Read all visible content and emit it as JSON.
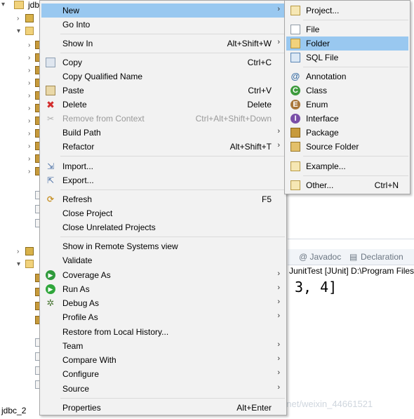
{
  "explorer": {
    "top_project_label": "jdb",
    "bottom_project_label": "jdbc_2"
  },
  "console": {
    "tabs": [
      "@ Javadoc",
      "Declaration"
    ],
    "run_label": "JunitTest [JUnit] D:\\Program Files",
    "output": "3, 4]"
  },
  "watermark": "https://blog.csdn.net/weixin_44661521",
  "menu": {
    "items": [
      {
        "label": "New",
        "shortcut": "",
        "submenu": true,
        "selected": true
      },
      {
        "label": "Go Into",
        "shortcut": ""
      },
      {
        "label": "Show In",
        "shortcut": "Alt+Shift+W",
        "submenu": true
      },
      {
        "label": "Copy",
        "shortcut": "Ctrl+C"
      },
      {
        "label": "Copy Qualified Name",
        "shortcut": ""
      },
      {
        "label": "Paste",
        "shortcut": "Ctrl+V"
      },
      {
        "label": "Delete",
        "shortcut": "Delete"
      },
      {
        "label": "Remove from Context",
        "shortcut": "Ctrl+Alt+Shift+Down",
        "disabled": true
      },
      {
        "label": "Build Path",
        "shortcut": "",
        "submenu": true
      },
      {
        "label": "Refactor",
        "shortcut": "Alt+Shift+T",
        "submenu": true
      },
      {
        "label": "Import...",
        "shortcut": ""
      },
      {
        "label": "Export...",
        "shortcut": ""
      },
      {
        "label": "Refresh",
        "shortcut": "F5"
      },
      {
        "label": "Close Project",
        "shortcut": ""
      },
      {
        "label": "Close Unrelated Projects",
        "shortcut": ""
      },
      {
        "label": "Show in Remote Systems view",
        "shortcut": ""
      },
      {
        "label": "Validate",
        "shortcut": ""
      },
      {
        "label": "Coverage As",
        "shortcut": "",
        "submenu": true
      },
      {
        "label": "Run As",
        "shortcut": "",
        "submenu": true
      },
      {
        "label": "Debug As",
        "shortcut": "",
        "submenu": true
      },
      {
        "label": "Profile As",
        "shortcut": "",
        "submenu": true
      },
      {
        "label": "Restore from Local History...",
        "shortcut": ""
      },
      {
        "label": "Team",
        "shortcut": "",
        "submenu": true
      },
      {
        "label": "Compare With",
        "shortcut": "",
        "submenu": true
      },
      {
        "label": "Configure",
        "shortcut": "",
        "submenu": true
      },
      {
        "label": "Source",
        "shortcut": "",
        "submenu": true
      },
      {
        "label": "Properties",
        "shortcut": "Alt+Enter"
      }
    ]
  },
  "submenu": {
    "items": [
      {
        "label": "Project...",
        "shortcut": ""
      },
      {
        "label": "File",
        "shortcut": ""
      },
      {
        "label": "Folder",
        "shortcut": "",
        "selected": true
      },
      {
        "label": "SQL File",
        "shortcut": ""
      },
      {
        "label": "Annotation",
        "shortcut": ""
      },
      {
        "label": "Class",
        "shortcut": ""
      },
      {
        "label": "Enum",
        "shortcut": ""
      },
      {
        "label": "Interface",
        "shortcut": ""
      },
      {
        "label": "Package",
        "shortcut": ""
      },
      {
        "label": "Source Folder",
        "shortcut": ""
      },
      {
        "label": "Example...",
        "shortcut": ""
      },
      {
        "label": "Other...",
        "shortcut": "Ctrl+N"
      }
    ]
  },
  "colors": {
    "menu_bg": "#f2f2f2",
    "selection": "#99c8f0",
    "disabled_text": "#9a9a9a"
  }
}
